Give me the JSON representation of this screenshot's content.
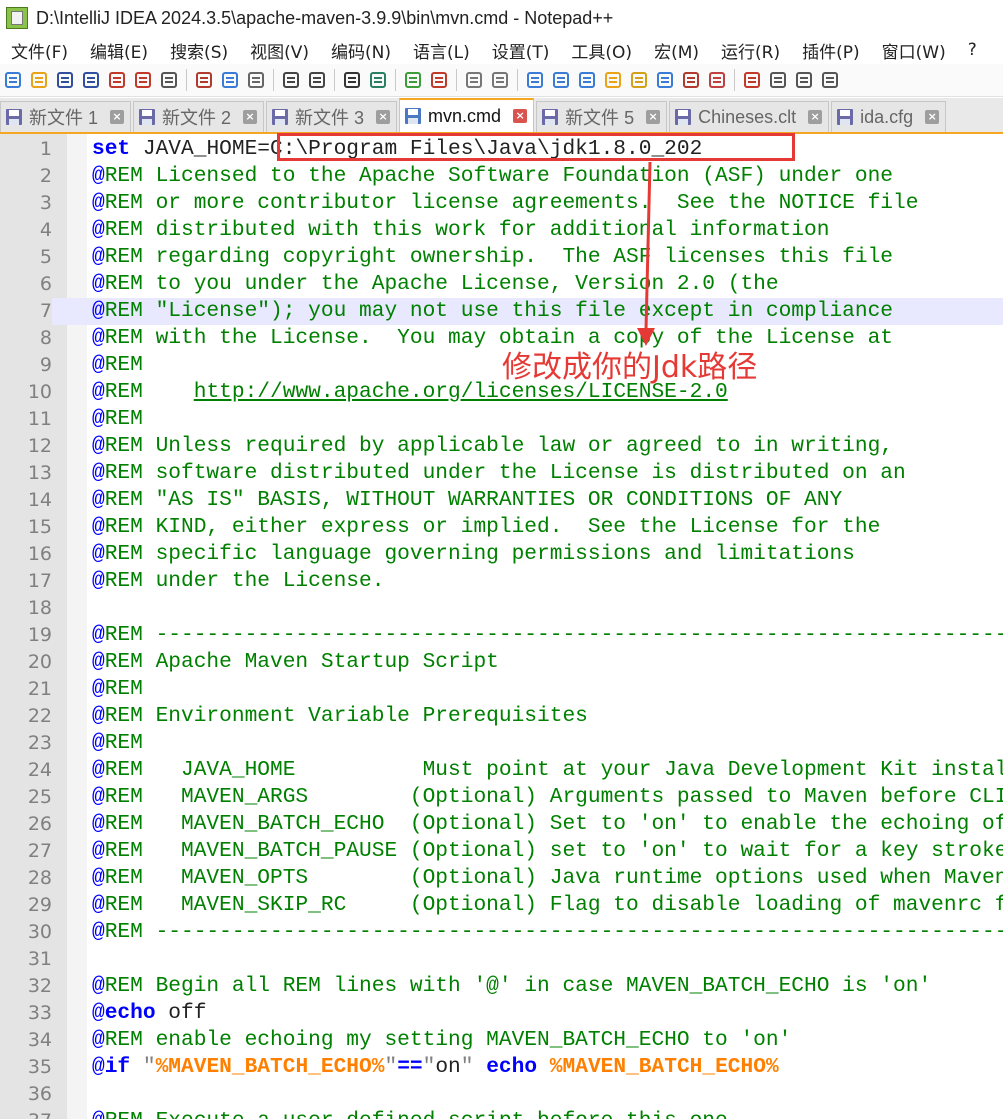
{
  "window": {
    "title": "D:\\IntelliJ IDEA 2024.3.5\\apache-maven-3.9.9\\bin\\mvn.cmd - Notepad++"
  },
  "menu": [
    "文件(F)",
    "编辑(E)",
    "搜索(S)",
    "视图(V)",
    "编码(N)",
    "语言(L)",
    "设置(T)",
    "工具(O)",
    "宏(M)",
    "运行(R)",
    "插件(P)",
    "窗口(W)",
    "?"
  ],
  "toolbar_icons": [
    "new-file-icon",
    "open-file-icon",
    "save-icon",
    "save-all-icon",
    "close-icon",
    "close-all-icon",
    "print-icon",
    "cut-icon",
    "copy-icon",
    "paste-icon",
    "undo-icon",
    "redo-icon",
    "find-icon",
    "replace-icon",
    "zoom-in-icon",
    "zoom-out-icon",
    "sync-vertical-icon",
    "sync-horizontal-icon",
    "word-wrap-icon",
    "show-all-chars-icon",
    "indent-guide-icon",
    "udl-icon",
    "doc-map-icon",
    "function-list-icon",
    "folder-workspace-icon",
    "monitoring-icon",
    "record-macro-icon",
    "stop-macro-icon",
    "play-macro-icon",
    "run-macro-icon"
  ],
  "tabs": [
    {
      "label": "新文件 1",
      "active": false
    },
    {
      "label": "新文件 2",
      "active": false
    },
    {
      "label": "新文件 3",
      "active": false
    },
    {
      "label": "mvn.cmd",
      "active": true
    },
    {
      "label": "新文件 5",
      "active": false
    },
    {
      "label": "Chineses.clt",
      "active": false
    },
    {
      "label": "ida.cfg",
      "active": false
    }
  ],
  "editor": {
    "current_line": 7,
    "lines": [
      {
        "n": "1",
        "parts": [
          [
            "kw",
            "set"
          ],
          [
            "op",
            " JAVA_HOME=C:\\Program Files\\Java\\jdk1.8.0_202"
          ]
        ]
      },
      {
        "n": "2",
        "parts": [
          [
            "at",
            "@"
          ],
          [
            "rem",
            "REM Licensed to the Apache Software Foundation (ASF) under one"
          ]
        ]
      },
      {
        "n": "3",
        "parts": [
          [
            "at",
            "@"
          ],
          [
            "rem",
            "REM or more contributor license agreements.  See the NOTICE file"
          ]
        ]
      },
      {
        "n": "4",
        "parts": [
          [
            "at",
            "@"
          ],
          [
            "rem",
            "REM distributed with this work for additional information"
          ]
        ]
      },
      {
        "n": "5",
        "parts": [
          [
            "at",
            "@"
          ],
          [
            "rem",
            "REM regarding copyright ownership.  The ASF licenses this file"
          ]
        ]
      },
      {
        "n": "6",
        "parts": [
          [
            "at",
            "@"
          ],
          [
            "rem",
            "REM to you under the Apache License, Version 2.0 (the"
          ]
        ]
      },
      {
        "n": "7",
        "parts": [
          [
            "at",
            "@"
          ],
          [
            "rem",
            "REM \"License\"); you may not use this file except in compliance"
          ]
        ]
      },
      {
        "n": "8",
        "parts": [
          [
            "at",
            "@"
          ],
          [
            "rem",
            "REM with the License.  You may obtain a copy of the License at"
          ]
        ]
      },
      {
        "n": "9",
        "parts": [
          [
            "at",
            "@"
          ],
          [
            "rem",
            "REM"
          ]
        ]
      },
      {
        "n": "10",
        "parts": [
          [
            "at",
            "@"
          ],
          [
            "rem",
            "REM    "
          ],
          [
            "url",
            "http://www.apache.org/licenses/LICENSE-2.0"
          ]
        ]
      },
      {
        "n": "11",
        "parts": [
          [
            "at",
            "@"
          ],
          [
            "rem",
            "REM"
          ]
        ]
      },
      {
        "n": "12",
        "parts": [
          [
            "at",
            "@"
          ],
          [
            "rem",
            "REM Unless required by applicable law or agreed to in writing,"
          ]
        ]
      },
      {
        "n": "13",
        "parts": [
          [
            "at",
            "@"
          ],
          [
            "rem",
            "REM software distributed under the License is distributed on an"
          ]
        ]
      },
      {
        "n": "14",
        "parts": [
          [
            "at",
            "@"
          ],
          [
            "rem",
            "REM \"AS IS\" BASIS, WITHOUT WARRANTIES OR CONDITIONS OF ANY"
          ]
        ]
      },
      {
        "n": "15",
        "parts": [
          [
            "at",
            "@"
          ],
          [
            "rem",
            "REM KIND, either express or implied.  See the License for the"
          ]
        ]
      },
      {
        "n": "16",
        "parts": [
          [
            "at",
            "@"
          ],
          [
            "rem",
            "REM specific language governing permissions and limitations"
          ]
        ]
      },
      {
        "n": "17",
        "parts": [
          [
            "at",
            "@"
          ],
          [
            "rem",
            "REM under the License."
          ]
        ]
      },
      {
        "n": "18",
        "parts": []
      },
      {
        "n": "19",
        "parts": [
          [
            "at",
            "@"
          ],
          [
            "rem",
            "REM -----------------------------------------------------------------------------"
          ]
        ]
      },
      {
        "n": "20",
        "parts": [
          [
            "at",
            "@"
          ],
          [
            "rem",
            "REM Apache Maven Startup Script"
          ]
        ]
      },
      {
        "n": "21",
        "parts": [
          [
            "at",
            "@"
          ],
          [
            "rem",
            "REM"
          ]
        ]
      },
      {
        "n": "22",
        "parts": [
          [
            "at",
            "@"
          ],
          [
            "rem",
            "REM Environment Variable Prerequisites"
          ]
        ]
      },
      {
        "n": "23",
        "parts": [
          [
            "at",
            "@"
          ],
          [
            "rem",
            "REM"
          ]
        ]
      },
      {
        "n": "24",
        "parts": [
          [
            "at",
            "@"
          ],
          [
            "rem",
            "REM   JAVA_HOME          Must point at your Java Development Kit installation."
          ]
        ]
      },
      {
        "n": "25",
        "parts": [
          [
            "at",
            "@"
          ],
          [
            "rem",
            "REM   MAVEN_ARGS        (Optional) Arguments passed to Maven before CLI arguments."
          ]
        ]
      },
      {
        "n": "26",
        "parts": [
          [
            "at",
            "@"
          ],
          [
            "rem",
            "REM   MAVEN_BATCH_ECHO  (Optional) Set to 'on' to enable the echoing of the batch commands."
          ]
        ]
      },
      {
        "n": "27",
        "parts": [
          [
            "at",
            "@"
          ],
          [
            "rem",
            "REM   MAVEN_BATCH_PAUSE (Optional) set to 'on' to wait for a key stroke before ending."
          ]
        ]
      },
      {
        "n": "28",
        "parts": [
          [
            "at",
            "@"
          ],
          [
            "rem",
            "REM   MAVEN_OPTS        (Optional) Java runtime options used when Maven is executed."
          ]
        ]
      },
      {
        "n": "29",
        "parts": [
          [
            "at",
            "@"
          ],
          [
            "rem",
            "REM   MAVEN_SKIP_RC     (Optional) Flag to disable loading of mavenrc files."
          ]
        ]
      },
      {
        "n": "30",
        "parts": [
          [
            "at",
            "@"
          ],
          [
            "rem",
            "REM -----------------------------------------------------------------------------"
          ]
        ]
      },
      {
        "n": "31",
        "parts": []
      },
      {
        "n": "32",
        "parts": [
          [
            "at",
            "@"
          ],
          [
            "rem",
            "REM Begin all REM lines with '@' in case MAVEN_BATCH_ECHO is 'on'"
          ]
        ]
      },
      {
        "n": "33",
        "parts": [
          [
            "at",
            "@"
          ],
          [
            "kw",
            "echo"
          ],
          [
            "op",
            " off"
          ]
        ]
      },
      {
        "n": "34",
        "parts": [
          [
            "at",
            "@"
          ],
          [
            "rem",
            "REM enable echoing my setting MAVEN_BATCH_ECHO to 'on'"
          ]
        ]
      },
      {
        "n": "35",
        "parts": [
          [
            "at",
            "@"
          ],
          [
            "kw",
            "if"
          ],
          [
            "op",
            " "
          ],
          [
            "str",
            "\""
          ],
          [
            "var",
            "%MAVEN_BATCH_ECHO%"
          ],
          [
            "str",
            "\""
          ],
          [
            "kw",
            "=="
          ],
          [
            "str",
            "\""
          ],
          [
            "op",
            "on"
          ],
          [
            "str",
            "\""
          ],
          [
            "op",
            " "
          ],
          [
            "kw",
            "echo"
          ],
          [
            "op",
            " "
          ],
          [
            "var",
            "%MAVEN_BATCH_ECHO%"
          ]
        ]
      },
      {
        "n": "36",
        "parts": []
      },
      {
        "n": "37",
        "parts": [
          [
            "at",
            "@"
          ],
          [
            "rem",
            "REM Execute a user defined script before this one"
          ]
        ]
      }
    ]
  },
  "annotation": {
    "text": "修改成你的Jdk路径",
    "color": "#e53935"
  }
}
